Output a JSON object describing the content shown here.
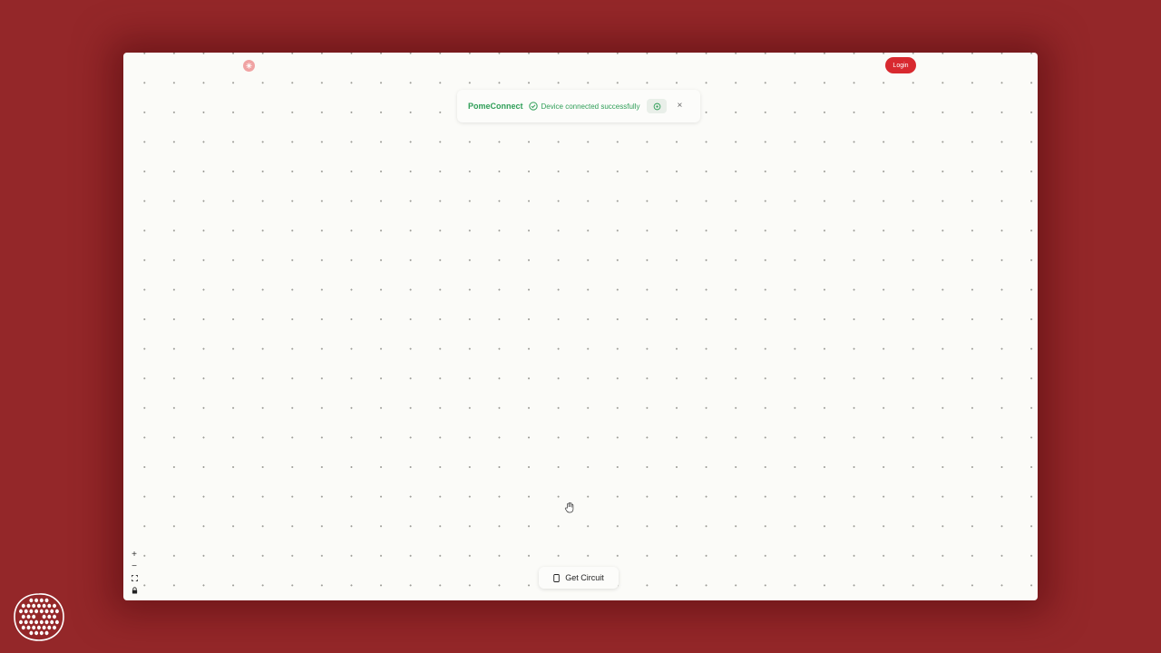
{
  "header": {
    "logo_icon": "pomegranate-logo-icon",
    "login_label": "Login"
  },
  "toast": {
    "brand": "PomeConnect",
    "status_icon": "check-circle-icon",
    "message": "Device connected successfully",
    "action_icon": "refresh-icon",
    "close_label": "×"
  },
  "canvas": {
    "cursor_icon": "hand-cursor-icon"
  },
  "zoom_controls": {
    "zoom_in_label": "+",
    "zoom_out_label": "−",
    "fit_view_icon": "fit-view-icon",
    "lock_icon": "lock-icon"
  },
  "bottom_bar": {
    "get_circuit_label": "Get Circuit",
    "get_circuit_icon": "device-icon"
  },
  "branding": {
    "corner_logo_icon": "pomegranate-seeds-logo-icon"
  },
  "colors": {
    "background": "#942729",
    "accent": "#d8292f",
    "success": "#2e9e57",
    "canvas": "#fbfbf8"
  }
}
